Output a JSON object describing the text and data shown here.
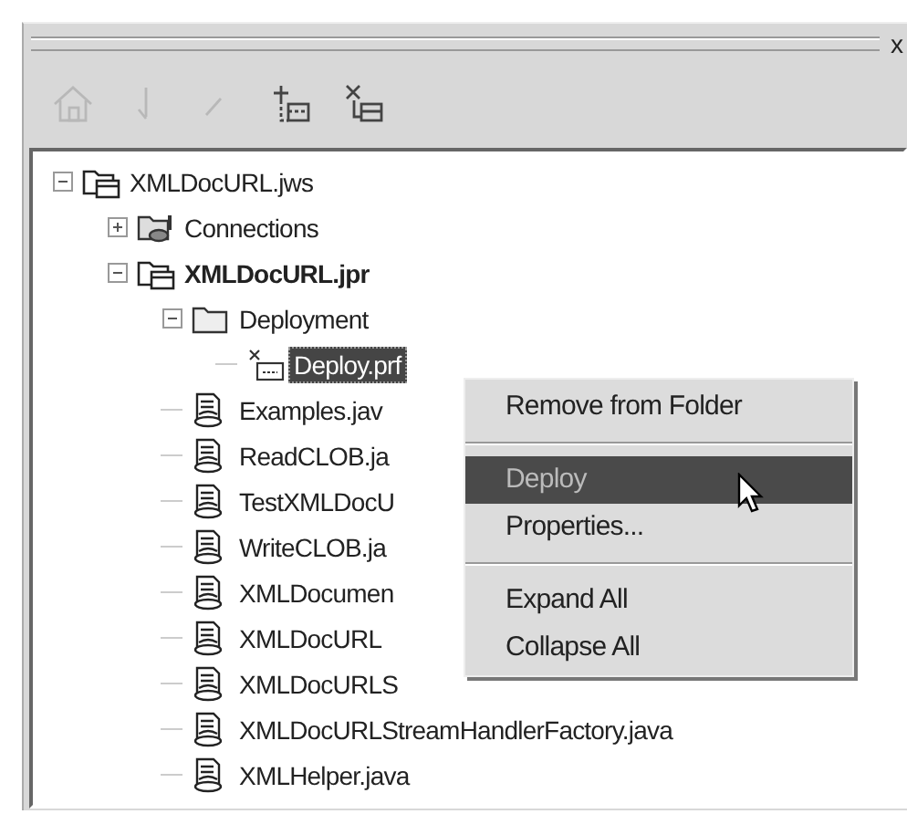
{
  "title_bar": {
    "close": "x"
  },
  "toolbar": [
    {
      "kind": "home",
      "disabled": true
    },
    {
      "kind": "down",
      "disabled": true
    },
    {
      "kind": "check",
      "disabled": true
    },
    {
      "kind": "add",
      "disabled": false
    },
    {
      "kind": "remove",
      "disabled": false
    }
  ],
  "tree": [
    {
      "label": "XMLDocURL.jws",
      "kind": "workspace",
      "bold": false,
      "selected": false,
      "expanded": true,
      "children": [
        {
          "label": "Connections",
          "kind": "connections",
          "bold": false,
          "selected": false,
          "expanded": false
        },
        {
          "label": "XMLDocURL.jpr",
          "kind": "project",
          "bold": true,
          "selected": false,
          "expanded": true,
          "children": [
            {
              "label": "Deployment",
              "kind": "folder",
              "bold": false,
              "selected": false,
              "expanded": true,
              "children": [
                {
                  "label": "Deploy.prf",
                  "kind": "deploy",
                  "bold": false,
                  "selected": true
                }
              ]
            },
            {
              "label": "Examples.jav",
              "kind": "java",
              "bold": false,
              "selected": false
            },
            {
              "label": "ReadCLOB.ja",
              "kind": "java",
              "bold": false,
              "selected": false
            },
            {
              "label": "TestXMLDocU",
              "kind": "java",
              "bold": false,
              "selected": false
            },
            {
              "label": "WriteCLOB.ja",
              "kind": "java",
              "bold": false,
              "selected": false
            },
            {
              "label": "XMLDocumen",
              "kind": "java",
              "bold": false,
              "selected": false
            },
            {
              "label": "XMLDocURL",
              "kind": "java",
              "bold": false,
              "selected": false
            },
            {
              "label": "XMLDocURLS",
              "kind": "java",
              "bold": false,
              "selected": false
            },
            {
              "label": "XMLDocURLStreamHandlerFactory.java",
              "kind": "java",
              "bold": false,
              "selected": false
            },
            {
              "label": "XMLHelper.java",
              "kind": "java",
              "bold": false,
              "selected": false
            }
          ]
        }
      ]
    }
  ],
  "context_menu": {
    "items": [
      {
        "kind": "item",
        "label": "Remove from Folder",
        "selected": false
      },
      {
        "kind": "separator"
      },
      {
        "kind": "item",
        "label": "Deploy",
        "selected": true
      },
      {
        "kind": "item",
        "label": "Properties...",
        "selected": false
      },
      {
        "kind": "separator"
      },
      {
        "kind": "item",
        "label": "Expand All",
        "selected": false
      },
      {
        "kind": "item",
        "label": "Collapse All",
        "selected": false
      }
    ]
  }
}
